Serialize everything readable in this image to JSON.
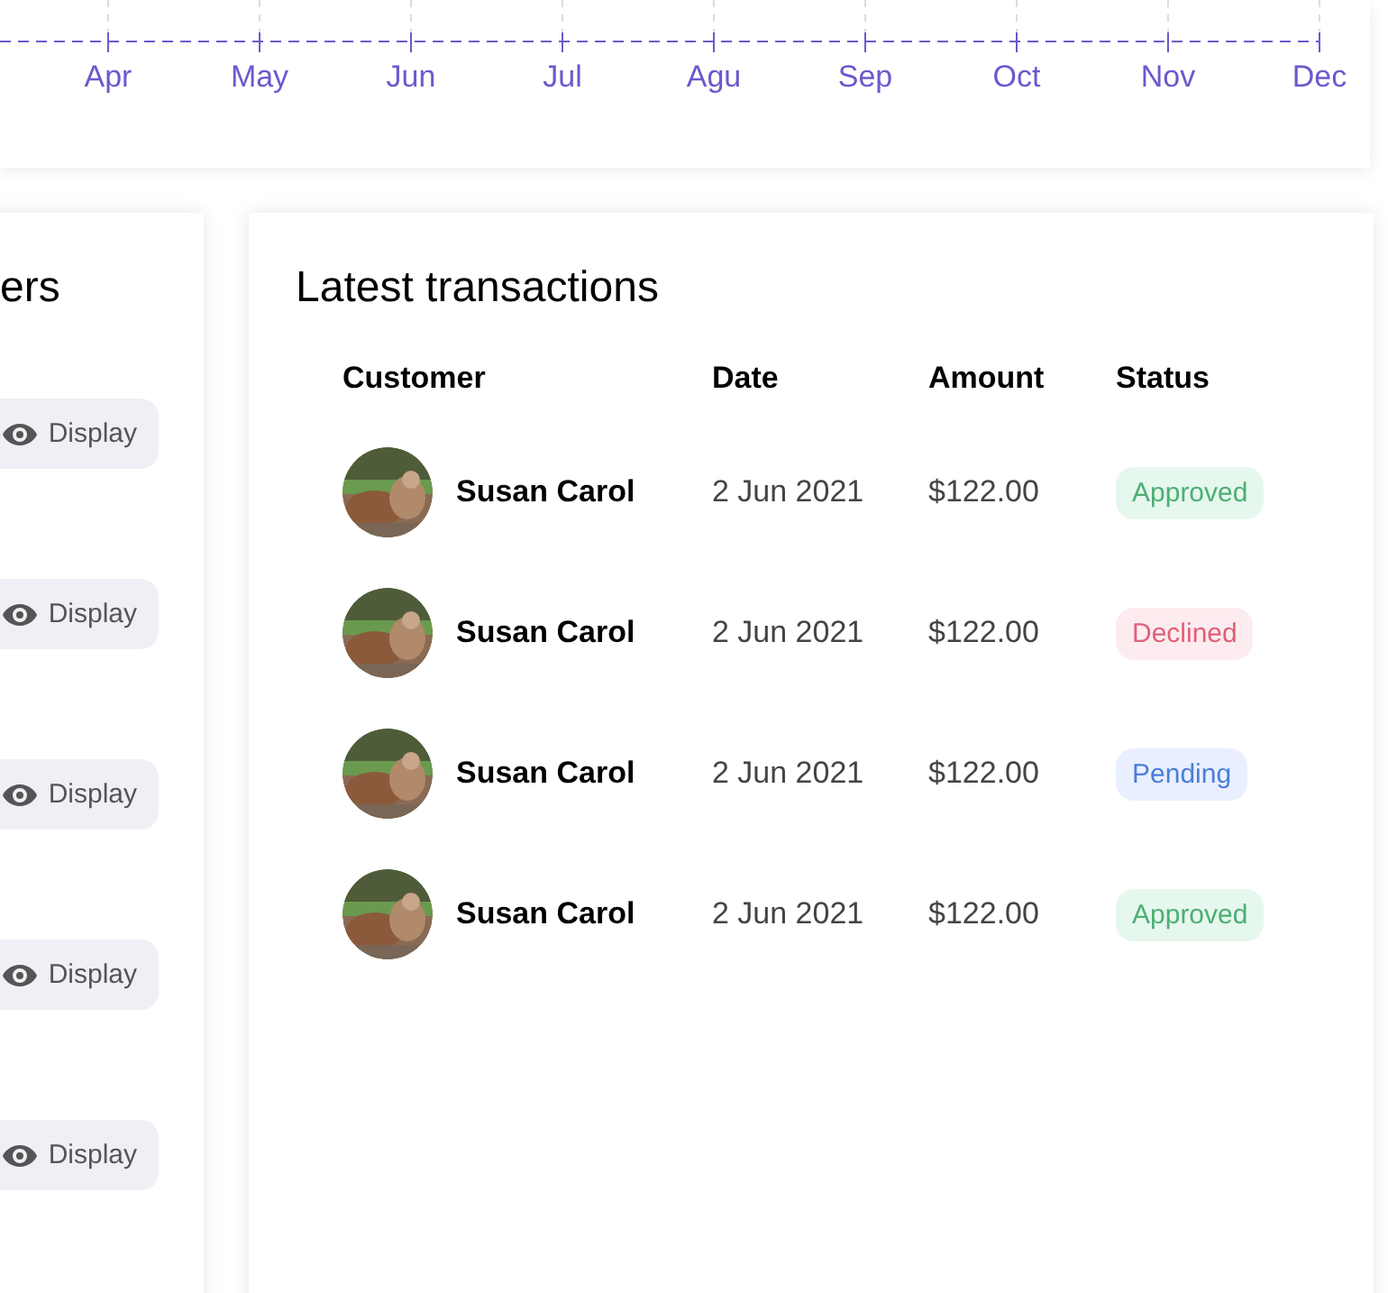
{
  "chart_axis": {
    "months": [
      "Apr",
      "May",
      "Jun",
      "Jul",
      "Agu",
      "Sep",
      "Oct",
      "Nov",
      "Dec"
    ]
  },
  "left_card": {
    "title": "ers",
    "buttons": [
      {
        "label": "Display"
      },
      {
        "label": "Display"
      },
      {
        "label": "Display"
      },
      {
        "label": "Display"
      },
      {
        "label": "Display"
      }
    ]
  },
  "transactions": {
    "title": "Latest transactions",
    "columns": [
      "Customer",
      "Date",
      "Amount",
      "Status"
    ],
    "rows": [
      {
        "customer": "Susan Carol",
        "date": "2 Jun 2021",
        "amount": "$122.00",
        "status": "Approved",
        "kind": "approved"
      },
      {
        "customer": "Susan Carol",
        "date": "2 Jun 2021",
        "amount": "$122.00",
        "status": "Declined",
        "kind": "declined"
      },
      {
        "customer": "Susan Carol",
        "date": "2 Jun 2021",
        "amount": "$122.00",
        "status": "Pending",
        "kind": "pending"
      },
      {
        "customer": "Susan Carol",
        "date": "2 Jun 2021",
        "amount": "$122.00",
        "status": "Approved",
        "kind": "approved"
      }
    ]
  }
}
